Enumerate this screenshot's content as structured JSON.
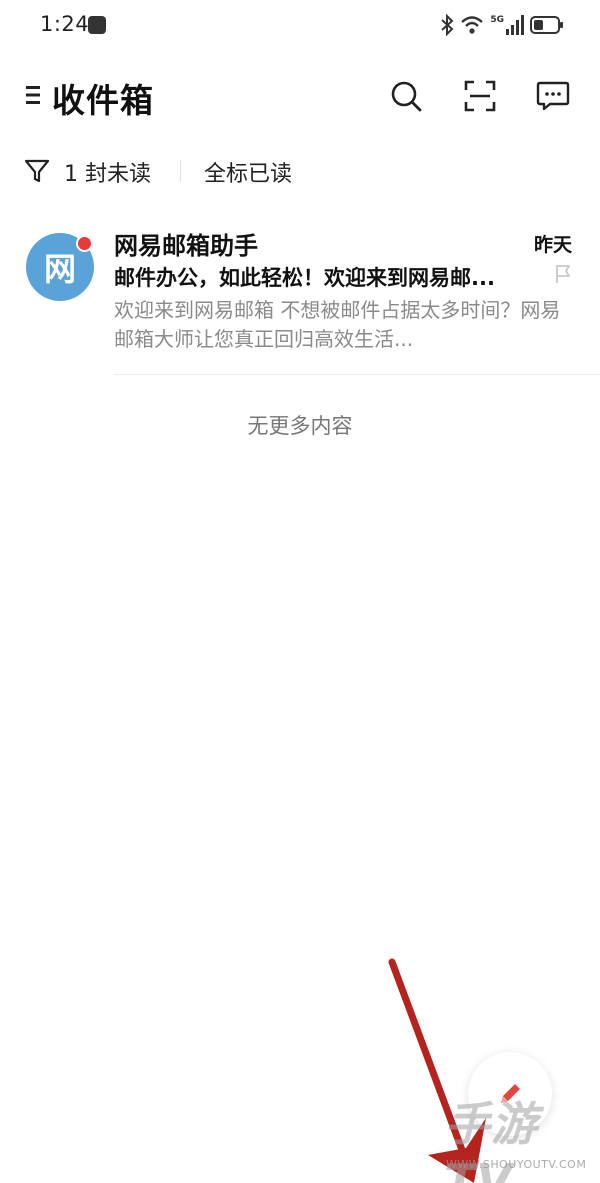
{
  "status_bar": {
    "time": "1:24",
    "network": "5G"
  },
  "header": {
    "title": "收件箱"
  },
  "filter_bar": {
    "unread_label": "1 封未读",
    "mark_all_label": "全标已读"
  },
  "mail_list": [
    {
      "avatar_text": "网",
      "sender": "网易邮箱助手",
      "date": "昨天",
      "subject": "邮件办公，如此轻松！欢迎来到网易邮...",
      "preview": "欢迎来到网易邮箱 不想被邮件占据太多时间？网易邮箱大师让您真正回归高效生活...",
      "unread": true
    }
  ],
  "list_footer": "无更多内容",
  "watermark": {
    "logo": "手游TV",
    "url": "WWW.SHOUYOUTV.COM"
  },
  "colors": {
    "avatar_bg": "#5aa3d9",
    "unread_dot": "#e83a3a",
    "annotation_arrow": "#b5231f"
  },
  "icons": {
    "menu": "menu-icon",
    "search": "search-icon",
    "scan": "scan-icon",
    "messages": "message-icon",
    "filter": "filter-icon",
    "flag": "flag-icon",
    "compose": "pencil-icon"
  }
}
